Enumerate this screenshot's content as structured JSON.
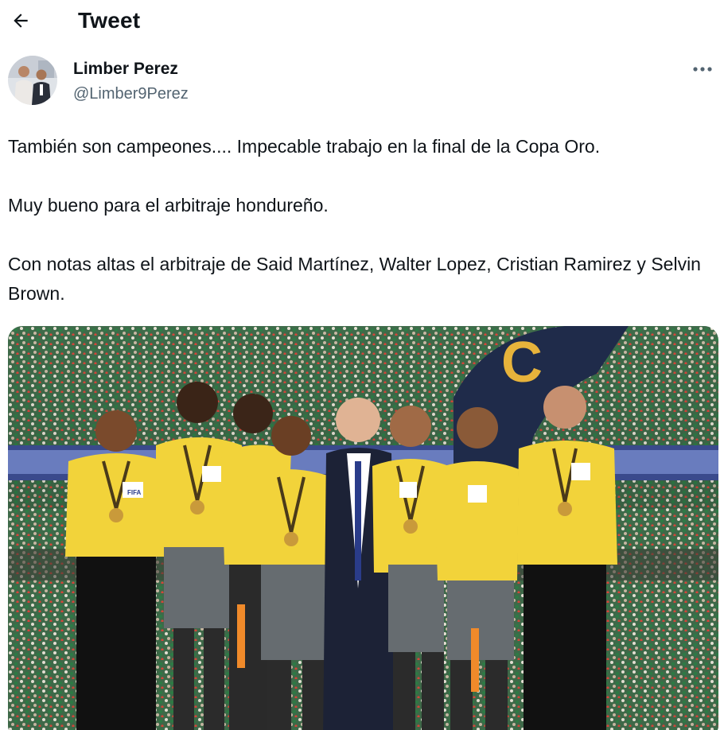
{
  "header": {
    "title": "Tweet",
    "back_icon": "arrow-left-icon"
  },
  "author": {
    "display_name": "Limber Perez",
    "handle": "@Limber9Perez",
    "more_icon": "more-horizontal-icon"
  },
  "tweet": {
    "paragraphs": [
      "También son campeones.... Impecable trabajo en la final de la Copa Oro.",
      "Muy bueno para el arbitraje hondureño.",
      "Con notas altas el arbitraje de Said Martínez, Walter Lopez, Cristian Ramirez y Selvin Brown."
    ]
  },
  "media": {
    "badge_text": "FIFA"
  },
  "colors": {
    "text_primary": "#0f1419",
    "text_secondary": "#536471",
    "jersey_yellow": "#f2d33a"
  }
}
